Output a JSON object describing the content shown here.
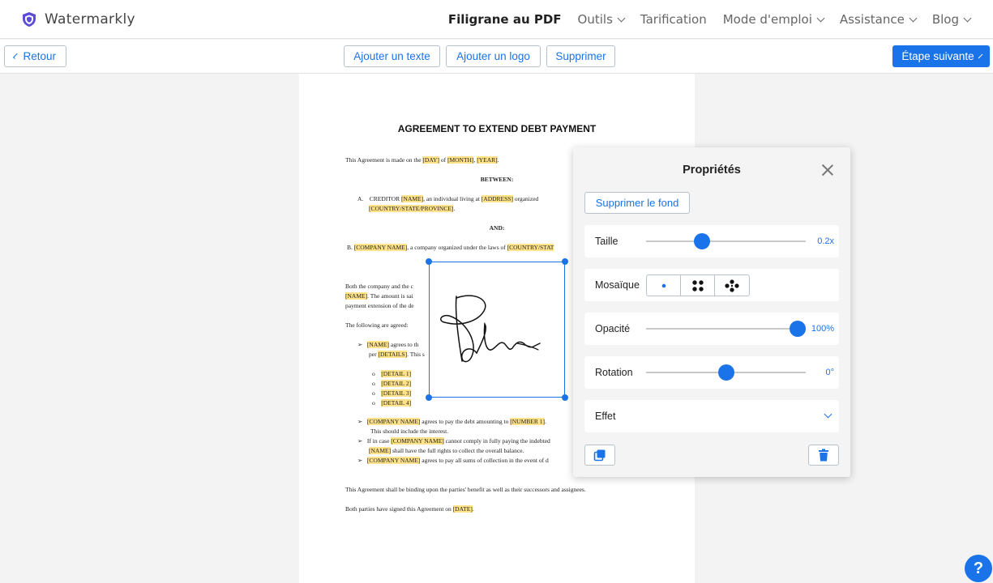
{
  "brand": {
    "name": "Watermarkly",
    "logo_icon": "shield-logo-icon"
  },
  "nav": {
    "items": [
      {
        "label": "Filigrane au PDF",
        "active": true,
        "dropdown": false
      },
      {
        "label": "Outils",
        "dropdown": true
      },
      {
        "label": "Tarification",
        "dropdown": false
      },
      {
        "label": "Mode d'emploi",
        "dropdown": true
      },
      {
        "label": "Assistance",
        "dropdown": true
      },
      {
        "label": "Blog",
        "dropdown": true
      }
    ]
  },
  "toolbar": {
    "back_label": "Retour",
    "add_text_label": "Ajouter un texte",
    "add_logo_label": "Ajouter un logo",
    "delete_label": "Supprimer",
    "next_label": "Étape suivante"
  },
  "document": {
    "title": "AGREEMENT TO EXTEND DEBT PAYMENT",
    "intro": {
      "prefix": "This Agreement is made on the",
      "day": "[DAY]",
      "of": "of",
      "month": "[MONTH]",
      "comma": ",",
      "year": "[YEAR]",
      "end": "."
    },
    "between": "BETWEEN:",
    "creditor": {
      "marker": "A.",
      "text1": "CREDITOR",
      "name": "[NAME]",
      "text2": ", an individual living at",
      "address": "[ADDRESS]",
      "text3": "organized",
      "country": "[COUNTRY/STATE/PROVINCE]",
      "end": "."
    },
    "and": "AND:",
    "company": {
      "marker": "B.",
      "name": "[COMPANY NAME]",
      "text": ", a company organized under the laws of",
      "country": "[COUNTRY/STAT"
    },
    "para": {
      "line1": "Both the company and the c",
      "name": "[NAME]",
      "line2": ". The amount is sai",
      "line3": "payment extension of the de"
    },
    "agreed": "The following are agreed:",
    "bullet1": {
      "name": "[NAME]",
      "text": "agrees to th",
      "per": "per",
      "details": "[DETAILS]",
      "text2": ". This s"
    },
    "details": [
      "[DETAIL 1]",
      "[DETAIL 2]",
      "[DETAIL 3]",
      "[DETAIL 4]"
    ],
    "bullet2": {
      "company": "[COMPANY NAME]",
      "text": "agrees to pay the debt amounting to",
      "number": "[NUMBER 1]",
      "end": ".",
      "line2": "This should include the interest."
    },
    "bullet3": {
      "prefix": "If in case",
      "company": "[COMPANY NAME]",
      "text": "cannot comply in fully paying the indebted",
      "name": "[NAME]",
      "text2": "shall have the full rights to collect the overall balance."
    },
    "bullet4": {
      "company": "[COMPANY NAME]",
      "text": "agrees to pay all sums of collection in the event of d"
    },
    "binding": "This Agreement shall be binding upon the parties' benefit as well as their successors and assignees.",
    "signed": {
      "prefix": "Both parties have signed this Agreement on",
      "date": "[DATE]",
      "end": "."
    }
  },
  "properties": {
    "title": "Propriétés",
    "remove_bg_label": "Supprimer le fond",
    "size": {
      "label": "Taille",
      "value": "0.2x",
      "slider": 0.35
    },
    "mosaic": {
      "label": "Mosaïque",
      "options": [
        "single-dot",
        "four-dots",
        "five-dots"
      ],
      "selected": 0
    },
    "opacity": {
      "label": "Opacité",
      "value": "100%",
      "slider": 0.95
    },
    "rotation": {
      "label": "Rotation",
      "value": "0°",
      "slider": 0.5
    },
    "effect": {
      "label": "Effet"
    }
  },
  "help": {
    "label": "?"
  },
  "colors": {
    "accent": "#1a73e8",
    "highlight": "#ffe28a"
  }
}
